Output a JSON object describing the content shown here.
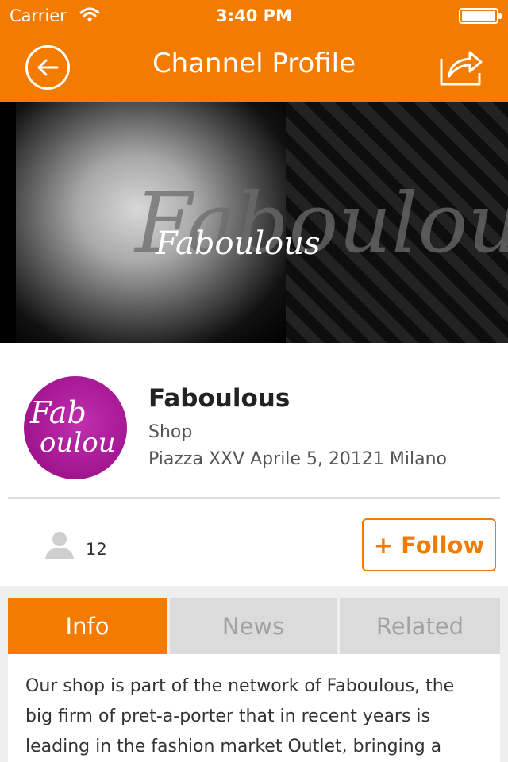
{
  "status_bar": {
    "carrier": "Carrier",
    "time": "3:40 PM",
    "icons": [
      "wifi-icon",
      "battery-icon"
    ]
  },
  "nav": {
    "title": "Channel Profile",
    "back_icon": "back-arrow-icon",
    "share_icon": "share-icon"
  },
  "banner": {
    "brand_wordmark": "Faboulous"
  },
  "channel": {
    "logo_text_line1": "Fab",
    "logo_text_line2": "oulou",
    "name": "Faboulous",
    "type": "Shop",
    "address": "Piazza XXV Aprile 5, 20121 Milano"
  },
  "stats": {
    "followers_icon": "person-icon",
    "followers": "12",
    "follow_button": "+ Follow"
  },
  "tabs": [
    {
      "label": "Info",
      "active": true
    },
    {
      "label": "News",
      "active": false
    },
    {
      "label": "Related",
      "active": false
    }
  ],
  "info": {
    "description": "Our shop is part of the network of Faboulous, the big firm of pret-a-porter that in recent years is leading in the fashion market Outlet, bringing a"
  },
  "colors": {
    "accent": "#f37b00",
    "logo_purple": "#a1148f",
    "inactive_tab": "#dbdbdb"
  }
}
